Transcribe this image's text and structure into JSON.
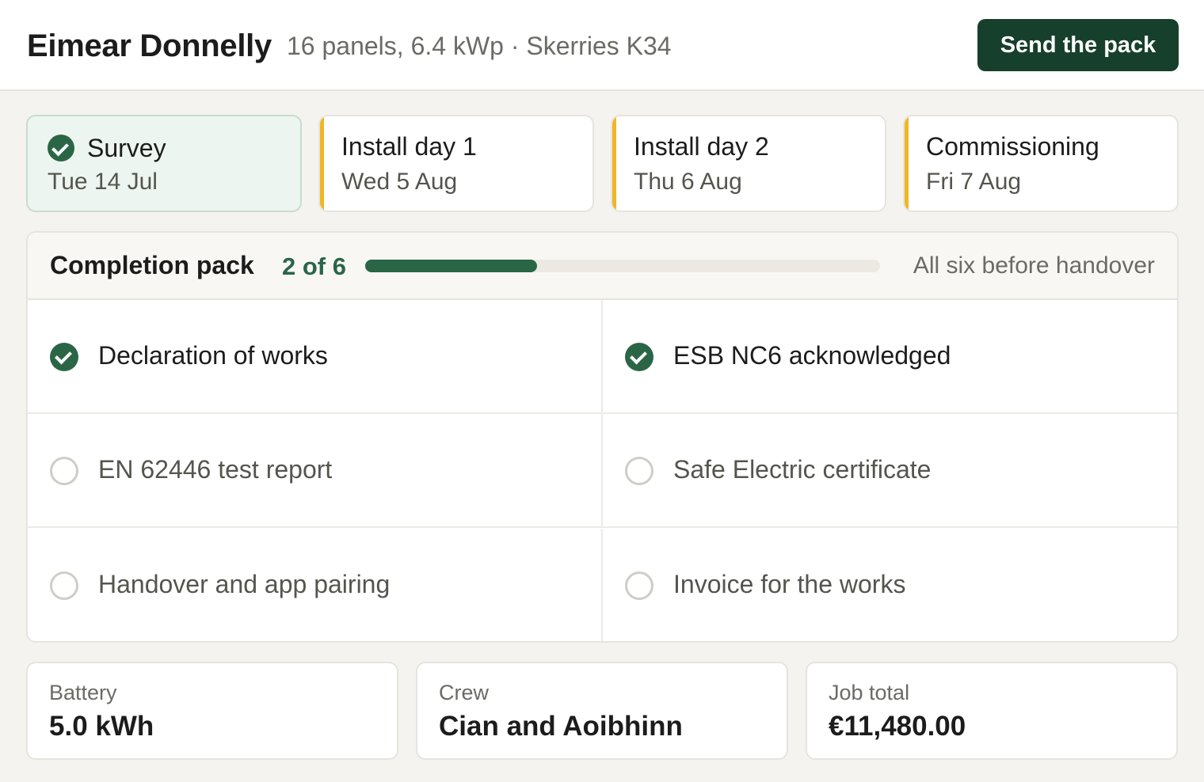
{
  "header": {
    "client_name": "Eimear Donnelly",
    "meta": "16 panels, 6.4 kWp · Skerries K34",
    "send_label": "Send the pack"
  },
  "stages": [
    {
      "title": "Survey",
      "date": "Tue 14 Jul",
      "status": "done"
    },
    {
      "title": "Install day 1",
      "date": "Wed 5 Aug",
      "status": "pending"
    },
    {
      "title": "Install day 2",
      "date": "Thu 6 Aug",
      "status": "pending"
    },
    {
      "title": "Commissioning",
      "date": "Fri 7 Aug",
      "status": "pending"
    }
  ],
  "pack": {
    "title": "Completion pack",
    "count_label": "2 of 6",
    "completed": 2,
    "total": 6,
    "note": "All six before handover",
    "items": [
      {
        "label": "Declaration of works",
        "done": true
      },
      {
        "label": "ESB NC6 acknowledged",
        "done": true
      },
      {
        "label": "EN 62446 test report",
        "done": false
      },
      {
        "label": "Safe Electric certificate",
        "done": false
      },
      {
        "label": "Handover and app pairing",
        "done": false
      },
      {
        "label": "Invoice for the works",
        "done": false
      }
    ]
  },
  "facts": [
    {
      "label": "Battery",
      "value": "5.0 kWh"
    },
    {
      "label": "Crew",
      "value": "Cian and Aoibhinn"
    },
    {
      "label": "Job total",
      "value": "€11,480.00"
    }
  ],
  "colors": {
    "accent": "#17402c",
    "done": "#2a6646",
    "pending": "#f0b624",
    "background": "#f4f3ef"
  }
}
